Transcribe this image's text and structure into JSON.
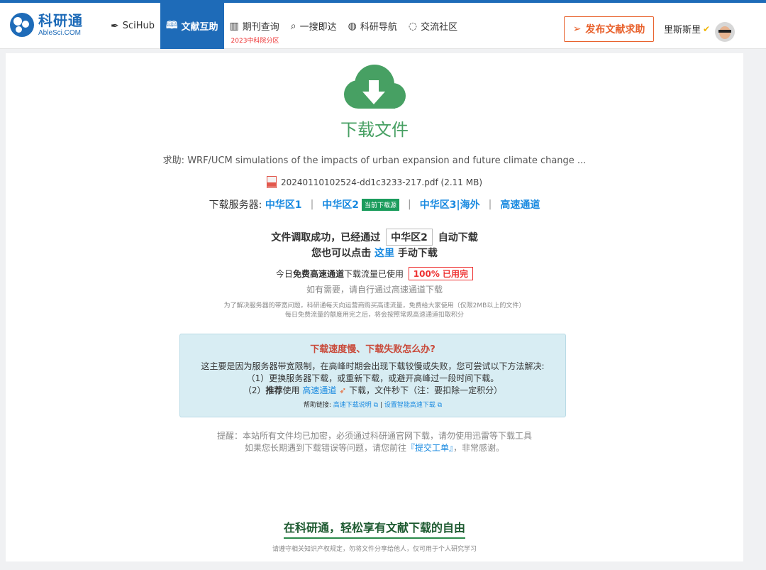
{
  "header": {
    "logo_cn": "科研通",
    "logo_en": "AbleSci.COM",
    "nav": [
      {
        "label": "SciHub",
        "icon": "quill-icon",
        "glyph": "✒"
      },
      {
        "label": "文献互助",
        "icon": "book-icon",
        "glyph": "📖"
      },
      {
        "label": "期刊查询",
        "icon": "journal-icon",
        "glyph": "▥",
        "sub": "2023中科院分区"
      },
      {
        "label": "一搜即达",
        "icon": "search-icon",
        "glyph": "⌕"
      },
      {
        "label": "科研导航",
        "icon": "globe-icon",
        "glyph": "◍"
      },
      {
        "label": "交流社区",
        "icon": "chat-icon",
        "glyph": "◌"
      }
    ],
    "publish_label": "发布文献求助",
    "publish_icon": "paper-plane-icon",
    "username": "里斯斯里",
    "accent": "#1e6bb8"
  },
  "main": {
    "download_title": "下载文件",
    "request_prefix": "求助:",
    "request_title": "WRF/UCM simulations of the impacts of urban expansion and future climate change ...",
    "file_name": "20240110102524-dd1c3233-217.pdf",
    "file_size": "(2.11 MB)",
    "servers_label": "下载服务器:",
    "servers": [
      "中华区1",
      "中华区2",
      "中华区3|海外",
      "高速通道"
    ],
    "current_tag": "当前下载源",
    "status_prefix": "文件调取成功，已经通过",
    "status_server": "中华区2",
    "status_suffix": "自动下载",
    "manual_prefix": "您也可以点击",
    "manual_link": "这里",
    "manual_suffix": "手动下载",
    "quota_prefix": "今日",
    "quota_bold": "免费高速通道",
    "quota_mid": "下载流量已使用",
    "quota_value": "100%  已用完",
    "quota_hint": "如有需要，请自行通过高速通道下载",
    "note_line1": "为了解决服务器的带宽问题，科研通每天向运营商购买高速流量，免费给大家使用（仅限2MB以上的文件）",
    "note_line2": "每日免费流量的额度用完之后，将会按照常规高速通道扣取积分"
  },
  "help": {
    "title": "下载速度慢、下载失败怎么办?",
    "line1": "这主要是因为服务器带宽限制，在高峰时期会出现下载较慢或失败，您可尝试以下方法解决:",
    "line2": "（1）更换服务器下载，或重新下载，或避开高峰过一段时间下载。",
    "line3_pre": "（2）",
    "line3_bold": "推荐",
    "line3_mid": "使用",
    "line3_link": "高速通道",
    "line3_suf": "下载，文件秒下（注：要扣除一定积分）",
    "links_label": "帮助链接:",
    "link1": "高速下载说明",
    "link2": "设置智能高速下载",
    "link_sep": "|"
  },
  "footer": {
    "remind1": "提醒：本站所有文件均已加密，必须通过科研通官网下载，请勿使用迅雷等下载工具",
    "remind2_pre": "如果您长期遇到下载错误等问题，请您前往",
    "remind2_link": "『提交工单』",
    "remind2_suf": "，非常感谢。",
    "slogan": "在科研通，轻松享有文献下载的自由",
    "note": "请遵守相关知识产权规定，勿将文件分享给他人，仅可用于个人研究学习"
  }
}
